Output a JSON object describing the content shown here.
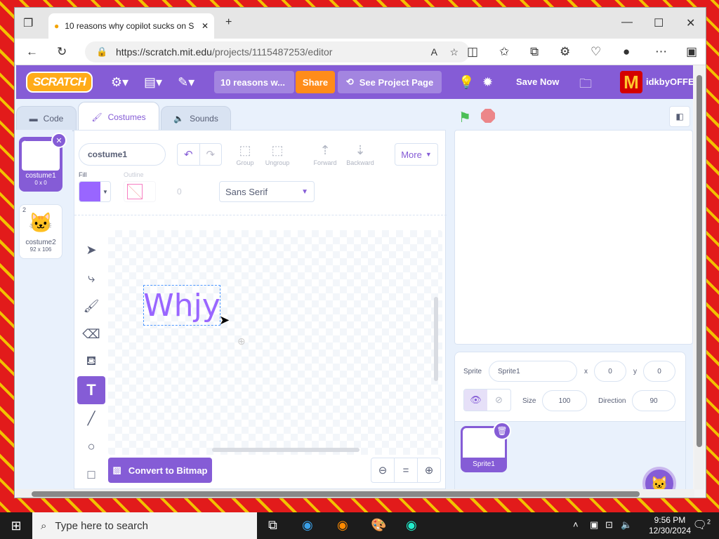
{
  "browser": {
    "tab_title": "10 reasons why copilot sucks on S",
    "url_host": "https://scratch.mit.edu",
    "url_path": "/projects/1115487253/editor"
  },
  "menubar": {
    "logo": "SCRATCH",
    "project_title": "10 reasons w...",
    "share": "Share",
    "see_project_page": "See Project Page",
    "save_now": "Save Now",
    "username": "idkbyOFFEN"
  },
  "editor_tabs": {
    "code": "Code",
    "costumes": "Costumes",
    "sounds": "Sounds"
  },
  "costumes": [
    {
      "num": "1",
      "name": "costume1",
      "size": "0 x 0"
    },
    {
      "num": "2",
      "name": "costume2",
      "size": "92 x 106"
    }
  ],
  "paint": {
    "costume_name": "costume1",
    "group": "Group",
    "ungroup": "Ungroup",
    "forward": "Forward",
    "backward": "Backward",
    "more": "More",
    "fill_label": "Fill",
    "outline_label": "Outline",
    "outline_width": "0",
    "font": "Sans Serif",
    "canvas_text": "Whjy",
    "convert_bitmap": "Convert to Bitmap",
    "zoom_reset": "="
  },
  "sprite_info": {
    "sprite_label": "Sprite",
    "sprite_name": "Sprite1",
    "x_label": "x",
    "x": "0",
    "y_label": "y",
    "y": "0",
    "size_label": "Size",
    "size": "100",
    "direction_label": "Direction",
    "direction": "90",
    "thumb_name": "Sprite1"
  },
  "taskbar": {
    "search_placeholder": "Type here to search",
    "time": "9:56 PM",
    "date": "12/30/2024",
    "notifications": "2"
  },
  "colors": {
    "accent": "#855cd6",
    "share": "#ff8c1a",
    "fill_color": "#9966ff"
  }
}
